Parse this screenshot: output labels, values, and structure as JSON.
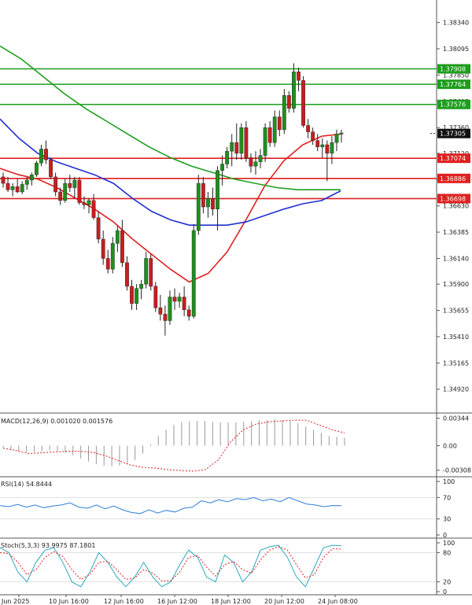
{
  "chart_data": {
    "type": "candlestick",
    "price_axis": {
      "ticks": [
        "1.38340",
        "1.38095",
        "1.37850",
        "1.37605",
        "1.37360",
        "1.37120",
        "1.36875",
        "1.36630",
        "1.36385",
        "1.36140",
        "1.35900",
        "1.35655",
        "1.35410",
        "1.35165",
        "1.34920"
      ],
      "ylim": [
        1.3472,
        1.3855
      ]
    },
    "current_price": 1.37305,
    "levels": [
      {
        "value": 1.37908,
        "label": "1.37908",
        "kind": "resistance",
        "color": "#1e9e1e"
      },
      {
        "value": 1.37764,
        "label": "1.37764",
        "kind": "resistance",
        "color": "#1e9e1e"
      },
      {
        "value": 1.37576,
        "label": "1.37576",
        "kind": "resistance",
        "color": "#1e9e1e"
      },
      {
        "value": 1.37074,
        "label": "1.37074",
        "kind": "support",
        "color": "#e02020"
      },
      {
        "value": 1.36886,
        "label": "1.36886",
        "kind": "support",
        "color": "#e02020"
      },
      {
        "value": 1.36698,
        "label": "1.36698",
        "kind": "support",
        "color": "#e02020"
      }
    ],
    "x_axis": {
      "ticks": [
        "Jun 2025",
        "10 Jun 16:00",
        "12 Jun 16:00",
        "16 Jun 12:00",
        "18 Jun 12:00",
        "20 Jun 12:00",
        "24 Jun 08:00"
      ]
    },
    "candles_ohlc": [
      [
        1.369,
        1.3694,
        1.368,
        1.3684
      ],
      [
        1.3684,
        1.369,
        1.3676,
        1.3678
      ],
      [
        1.3678,
        1.3684,
        1.3672,
        1.3681
      ],
      [
        1.3681,
        1.3688,
        1.3675,
        1.3676
      ],
      [
        1.3676,
        1.3686,
        1.3674,
        1.3683
      ],
      [
        1.3683,
        1.369,
        1.3678,
        1.3687
      ],
      [
        1.3687,
        1.3694,
        1.3682,
        1.3692
      ],
      [
        1.3692,
        1.3705,
        1.369,
        1.3703
      ],
      [
        1.3703,
        1.372,
        1.37,
        1.3716
      ],
      [
        1.3716,
        1.3724,
        1.3702,
        1.3706
      ],
      [
        1.3706,
        1.3708,
        1.3688,
        1.369
      ],
      [
        1.369,
        1.3694,
        1.3672,
        1.3676
      ],
      [
        1.3676,
        1.368,
        1.3664,
        1.3668
      ],
      [
        1.3668,
        1.3688,
        1.3666,
        1.3684
      ],
      [
        1.3684,
        1.3692,
        1.3676,
        1.368
      ],
      [
        1.368,
        1.369,
        1.367,
        1.3687
      ],
      [
        1.3687,
        1.369,
        1.3664,
        1.3666
      ],
      [
        1.3666,
        1.3672,
        1.366,
        1.3664
      ],
      [
        1.3664,
        1.367,
        1.3656,
        1.3668
      ],
      [
        1.3668,
        1.3674,
        1.365,
        1.3652
      ],
      [
        1.3652,
        1.3658,
        1.3628,
        1.3632
      ],
      [
        1.3632,
        1.364,
        1.3608,
        1.3614
      ],
      [
        1.3614,
        1.3622,
        1.36,
        1.3604
      ],
      [
        1.3604,
        1.3634,
        1.36,
        1.3628
      ],
      [
        1.3628,
        1.3644,
        1.362,
        1.364
      ],
      [
        1.364,
        1.365,
        1.3606,
        1.361
      ],
      [
        1.361,
        1.3616,
        1.3584,
        1.3588
      ],
      [
        1.3588,
        1.3594,
        1.3566,
        1.3572
      ],
      [
        1.3572,
        1.359,
        1.3566,
        1.3586
      ],
      [
        1.3586,
        1.3594,
        1.3576,
        1.359
      ],
      [
        1.359,
        1.362,
        1.3586,
        1.3614
      ],
      [
        1.3614,
        1.3618,
        1.3584,
        1.3588
      ],
      [
        1.3588,
        1.3592,
        1.3564,
        1.3568
      ],
      [
        1.3568,
        1.358,
        1.3556,
        1.3562
      ],
      [
        1.3562,
        1.357,
        1.3542,
        1.3556
      ],
      [
        1.3556,
        1.3584,
        1.3552,
        1.3578
      ],
      [
        1.3578,
        1.3586,
        1.3566,
        1.3574
      ],
      [
        1.3574,
        1.3582,
        1.3568,
        1.3578
      ],
      [
        1.3578,
        1.3588,
        1.356,
        1.3566
      ],
      [
        1.3566,
        1.357,
        1.3556,
        1.356
      ],
      [
        1.356,
        1.3646,
        1.3558,
        1.364
      ],
      [
        1.364,
        1.3692,
        1.3636,
        1.3684
      ],
      [
        1.3684,
        1.369,
        1.3656,
        1.3662
      ],
      [
        1.3662,
        1.3676,
        1.3652,
        1.367
      ],
      [
        1.367,
        1.368,
        1.3654,
        1.366
      ],
      [
        1.366,
        1.37,
        1.364,
        1.3696
      ],
      [
        1.3696,
        1.371,
        1.3682,
        1.3702
      ],
      [
        1.3702,
        1.3718,
        1.3698,
        1.3714
      ],
      [
        1.3714,
        1.373,
        1.37,
        1.3722
      ],
      [
        1.3722,
        1.374,
        1.3706,
        1.3712
      ],
      [
        1.3712,
        1.374,
        1.3706,
        1.3736
      ],
      [
        1.3736,
        1.3742,
        1.3704,
        1.3708
      ],
      [
        1.3708,
        1.3712,
        1.3694,
        1.37
      ],
      [
        1.37,
        1.3714,
        1.3692,
        1.3704
      ],
      [
        1.3704,
        1.3716,
        1.3698,
        1.371
      ],
      [
        1.371,
        1.374,
        1.3704,
        1.3736
      ],
      [
        1.3736,
        1.3742,
        1.3718,
        1.3722
      ],
      [
        1.3722,
        1.3752,
        1.3718,
        1.3746
      ],
      [
        1.3746,
        1.3752,
        1.3728,
        1.3734
      ],
      [
        1.3734,
        1.3772,
        1.373,
        1.3766
      ],
      [
        1.3766,
        1.377,
        1.375,
        1.3754
      ],
      [
        1.3754,
        1.3796,
        1.375,
        1.3788
      ],
      [
        1.3788,
        1.3792,
        1.377,
        1.378
      ],
      [
        1.378,
        1.3784,
        1.3736,
        1.3738
      ],
      [
        1.3738,
        1.3744,
        1.3726,
        1.3732
      ],
      [
        1.3732,
        1.3736,
        1.372,
        1.3724
      ],
      [
        1.3724,
        1.373,
        1.3714,
        1.3718
      ],
      [
        1.3718,
        1.3726,
        1.3708,
        1.372
      ],
      [
        1.372,
        1.3724,
        1.3686,
        1.3712
      ],
      [
        1.3712,
        1.3728,
        1.3702,
        1.3722
      ],
      [
        1.3722,
        1.3734,
        1.3714,
        1.373
      ],
      [
        1.373,
        1.3734,
        1.3722,
        1.3731
      ]
    ],
    "moving_averages": [
      {
        "color": "#e02020",
        "values": [
          1.3698,
          1.3692,
          1.3688,
          1.368,
          1.367,
          1.366,
          1.3648,
          1.3632,
          1.3618,
          1.3604,
          1.3592,
          1.36,
          1.362,
          1.365,
          1.3682,
          1.3705,
          1.372,
          1.3728,
          1.373
        ]
      },
      {
        "color": "#2030d0",
        "values": [
          1.3744,
          1.3726,
          1.3712,
          1.3704,
          1.3698,
          1.3692,
          1.3684,
          1.367,
          1.3658,
          1.365,
          1.3645,
          1.3645,
          1.3645,
          1.3648,
          1.3654,
          1.366,
          1.3665,
          1.3668,
          1.3677
        ]
      },
      {
        "color": "#1e9e1e",
        "values": [
          1.3812,
          1.38,
          1.3784,
          1.3768,
          1.3754,
          1.3742,
          1.373,
          1.3718,
          1.3708,
          1.37,
          1.3694,
          1.3688,
          1.3684,
          1.368,
          1.3678,
          1.3678,
          1.3678
        ]
      }
    ],
    "macd": {
      "label": "MACD(12,26,9) 0.001020 0.001576",
      "ticks": [
        "0.00344",
        "0.00",
        "-0.00308"
      ],
      "ylim": [
        -0.0036,
        0.0038
      ],
      "signal": [
        -0.0003,
        -0.0006,
        -0.001,
        -0.0009,
        -0.0008,
        -0.0007,
        -0.0007,
        -0.0008,
        -0.0012,
        -0.0018,
        -0.0024,
        -0.0027,
        -0.0028,
        -0.003,
        -0.0031,
        -0.0032,
        -0.003,
        -0.0018,
        0.0005,
        0.002,
        0.0027,
        0.003,
        0.0031,
        0.0032,
        0.0032,
        0.0026,
        0.002,
        0.0016
      ],
      "histogram": [
        -0.0002,
        -0.0005,
        -0.0007,
        -0.0008,
        -0.0008,
        -0.0007,
        -0.0006,
        -0.0007,
        -0.0009,
        -0.0012,
        -0.0016,
        -0.002,
        -0.0023,
        -0.0025,
        -0.0026,
        -0.0025,
        -0.0023,
        -0.0018,
        -0.001,
        0.0002,
        0.0012,
        0.002,
        0.0026,
        0.003,
        0.0031,
        0.0031,
        0.0031,
        0.003,
        0.0029,
        0.0029,
        0.0029,
        0.003,
        0.0031,
        0.0032,
        0.0032,
        0.0033,
        0.0032,
        0.0031,
        0.0028,
        0.0024,
        0.002,
        0.0016,
        0.0012,
        0.0011,
        0.001
      ]
    },
    "rsi": {
      "label": "RSI(14) 54.8444",
      "ticks": [
        "100",
        "70",
        "30",
        "0"
      ],
      "ylim": [
        0,
        100
      ],
      "values": [
        55,
        53,
        57,
        52,
        56,
        51,
        54,
        56,
        60,
        52,
        50,
        56,
        49,
        54,
        47,
        42,
        40,
        47,
        41,
        46,
        43,
        50,
        52,
        64,
        60,
        66,
        62,
        68,
        66,
        70,
        64,
        67,
        62,
        70,
        64,
        58,
        56,
        53,
        55,
        54.8
      ]
    },
    "stoch": {
      "label": "Stoch(5,3,3) 93.9975 87.1801",
      "ticks": [
        "100",
        "80",
        "20",
        "0"
      ],
      "ylim": [
        0,
        100
      ],
      "k": [
        90,
        80,
        40,
        20,
        60,
        85,
        90,
        60,
        20,
        10,
        40,
        80,
        60,
        30,
        10,
        30,
        60,
        30,
        10,
        20,
        55,
        85,
        70,
        30,
        20,
        75,
        60,
        20,
        40,
        85,
        92,
        95,
        70,
        30,
        10,
        50,
        90,
        95,
        94
      ],
      "d": [
        80,
        78,
        60,
        35,
        45,
        70,
        82,
        72,
        45,
        25,
        35,
        60,
        62,
        45,
        25,
        28,
        45,
        38,
        22,
        22,
        40,
        70,
        74,
        50,
        32,
        55,
        62,
        45,
        38,
        65,
        85,
        92,
        85,
        55,
        28,
        35,
        70,
        88,
        87
      ]
    }
  }
}
